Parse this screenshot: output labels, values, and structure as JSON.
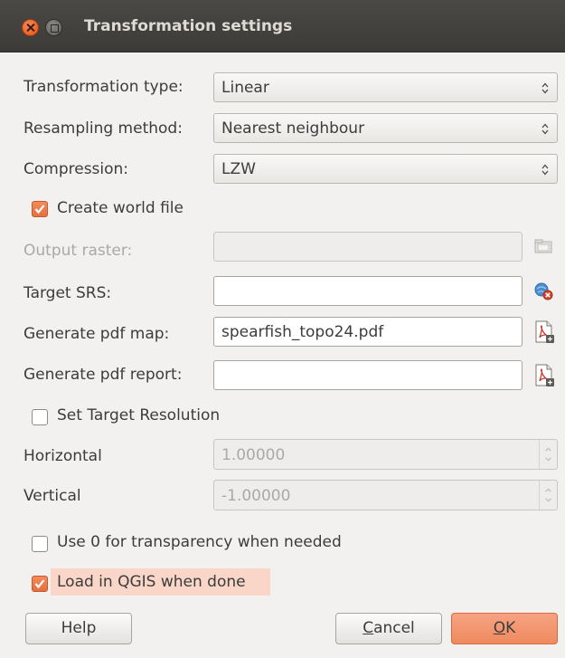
{
  "window": {
    "title": "Transformation settings"
  },
  "form": {
    "transformation_type": {
      "label": "Transformation type:",
      "value": "Linear"
    },
    "resampling_method": {
      "label": "Resampling method:",
      "value": "Nearest neighbour"
    },
    "compression": {
      "label": "Compression:",
      "value": "LZW"
    },
    "create_world_file": {
      "label": "Create world file",
      "checked": true
    },
    "output_raster": {
      "label": "Output raster:",
      "value": "",
      "enabled": false
    },
    "target_srs": {
      "label": "Target SRS:",
      "value": ""
    },
    "generate_pdf_map": {
      "label": "Generate pdf map:",
      "value": "spearfish_topo24.pdf"
    },
    "generate_pdf_report": {
      "label": "Generate pdf report:",
      "value": ""
    },
    "set_target_resolution": {
      "label": "Set Target Resolution",
      "checked": false
    },
    "horizontal": {
      "label": "Horizontal",
      "value": "1.00000",
      "enabled": false
    },
    "vertical": {
      "label": "Vertical",
      "value": "-1.00000",
      "enabled": false
    },
    "use_zero_transparency": {
      "label": "Use 0 for transparency when needed",
      "checked": false
    },
    "load_in_qgis": {
      "label": "Load in QGIS when done",
      "checked": true
    }
  },
  "buttons": {
    "help": "Help",
    "cancel_first": "C",
    "cancel_rest": "ancel",
    "ok_first": "O",
    "ok_rest": "K"
  },
  "colors": {
    "accent": "#ef8a5e",
    "titlebar": "#3c3b37",
    "highlight": "#f9d6c8"
  }
}
